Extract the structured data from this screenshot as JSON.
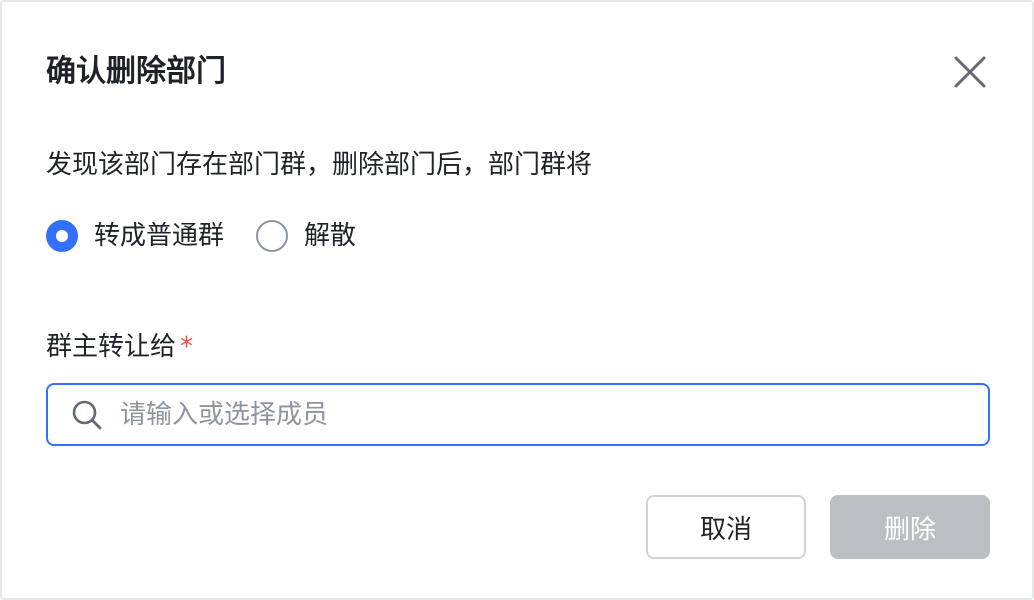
{
  "dialog": {
    "title": "确认删除部门",
    "description": "发现该部门存在部门群，删除部门后，部门群将",
    "radio_options": [
      {
        "label": "转成普通群",
        "checked": true
      },
      {
        "label": "解散",
        "checked": false
      }
    ],
    "transfer_label": "群主转让给",
    "required_mark": "*",
    "search_placeholder": "请输入或选择成员",
    "search_value": "",
    "cancel_label": "取消",
    "delete_label": "删除",
    "delete_enabled": false
  },
  "colors": {
    "accent": "#3370ff",
    "required": "#f54a45",
    "disabled_button": "#bbbfc4"
  },
  "icons": {
    "close": "close-icon",
    "search": "search-icon"
  }
}
